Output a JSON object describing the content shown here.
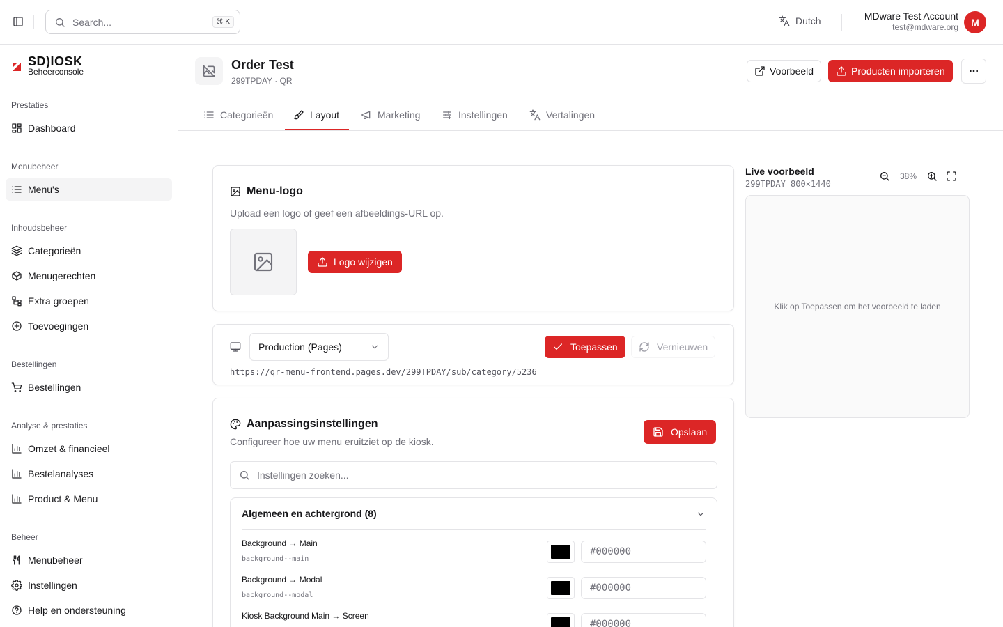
{
  "topbar": {
    "search_placeholder": "Search...",
    "search_shortcut": "⌘ K",
    "language": "Dutch",
    "account_name": "MDware Test Account",
    "account_email": "test@mdware.org",
    "avatar_initial": "M"
  },
  "brand": {
    "logo_text": "SD)IOSK",
    "subtitle": "Beheerconsole"
  },
  "sidebar": {
    "groups": [
      {
        "label": "Prestaties",
        "items": [
          {
            "label": "Dashboard",
            "icon": "dashboard-icon"
          }
        ]
      },
      {
        "label": "Menubeheer",
        "items": [
          {
            "label": "Menu's",
            "icon": "list-icon",
            "active": true
          }
        ]
      },
      {
        "label": "Inhoudsbeheer",
        "items": [
          {
            "label": "Categorieën",
            "icon": "layers-icon"
          },
          {
            "label": "Menugerechten",
            "icon": "package-icon"
          },
          {
            "label": "Extra groepen",
            "icon": "tree-icon"
          },
          {
            "label": "Toevoegingen",
            "icon": "plus-circle-icon"
          }
        ]
      },
      {
        "label": "Bestellingen",
        "items": [
          {
            "label": "Bestellingen",
            "icon": "cart-icon"
          }
        ]
      },
      {
        "label": "Analyse & prestaties",
        "items": [
          {
            "label": "Omzet & financieel",
            "icon": "chart-icon"
          },
          {
            "label": "Bestelanalyses",
            "icon": "chart-icon"
          },
          {
            "label": "Product & Menu",
            "icon": "chart-icon"
          }
        ]
      },
      {
        "label": "Beheer",
        "items": [
          {
            "label": "Menubeheer",
            "icon": "utensils-icon"
          }
        ]
      }
    ],
    "footer": [
      {
        "label": "Instellingen",
        "icon": "gear-icon"
      },
      {
        "label": "Help en ondersteuning",
        "icon": "help-icon"
      }
    ]
  },
  "page": {
    "title": "Order Test",
    "subtitle": "299TPDAY · QR",
    "preview_button": "Voorbeeld",
    "import_button": "Producten importeren"
  },
  "tabs": [
    {
      "label": "Categorieën",
      "active": false
    },
    {
      "label": "Layout",
      "active": true
    },
    {
      "label": "Marketing",
      "active": false
    },
    {
      "label": "Instellingen",
      "active": false
    },
    {
      "label": "Vertalingen",
      "active": false
    }
  ],
  "logo_card": {
    "title": "Menu-logo",
    "description": "Upload een logo of geef een afbeeldings-URL op.",
    "change_button": "Logo wijzigen"
  },
  "env_card": {
    "selected_env": "Production (Pages)",
    "apply_button": "Toepassen",
    "refresh_button": "Vernieuwen",
    "url": "https://qr-menu-frontend.pages.dev/299TPDAY/sub/category/5236"
  },
  "custom_card": {
    "title": "Aanpassingsinstellingen",
    "description": "Configureer hoe uw menu eruitziet op de kiosk.",
    "save_button": "Opslaan",
    "search_placeholder": "Instellingen zoeken...",
    "section_title": "Algemeen en achtergrond (8)",
    "rows": [
      {
        "label": "Background → Main",
        "var": "background--main",
        "value": "#000000"
      },
      {
        "label": "Background → Modal",
        "var": "background--modal",
        "value": "#000000"
      },
      {
        "label": "Kiosk Background Main → Screen",
        "var": "",
        "value": "#000000"
      }
    ]
  },
  "preview": {
    "title": "Live voorbeeld",
    "code": "299TPDAY",
    "resolution": "800×1440",
    "zoom": "38%",
    "placeholder": "Klik op Toepassen om het voorbeeld te laden"
  },
  "colors": {
    "accent": "#dc2626",
    "border": "#e4e4e7",
    "muted": "#71717a"
  }
}
